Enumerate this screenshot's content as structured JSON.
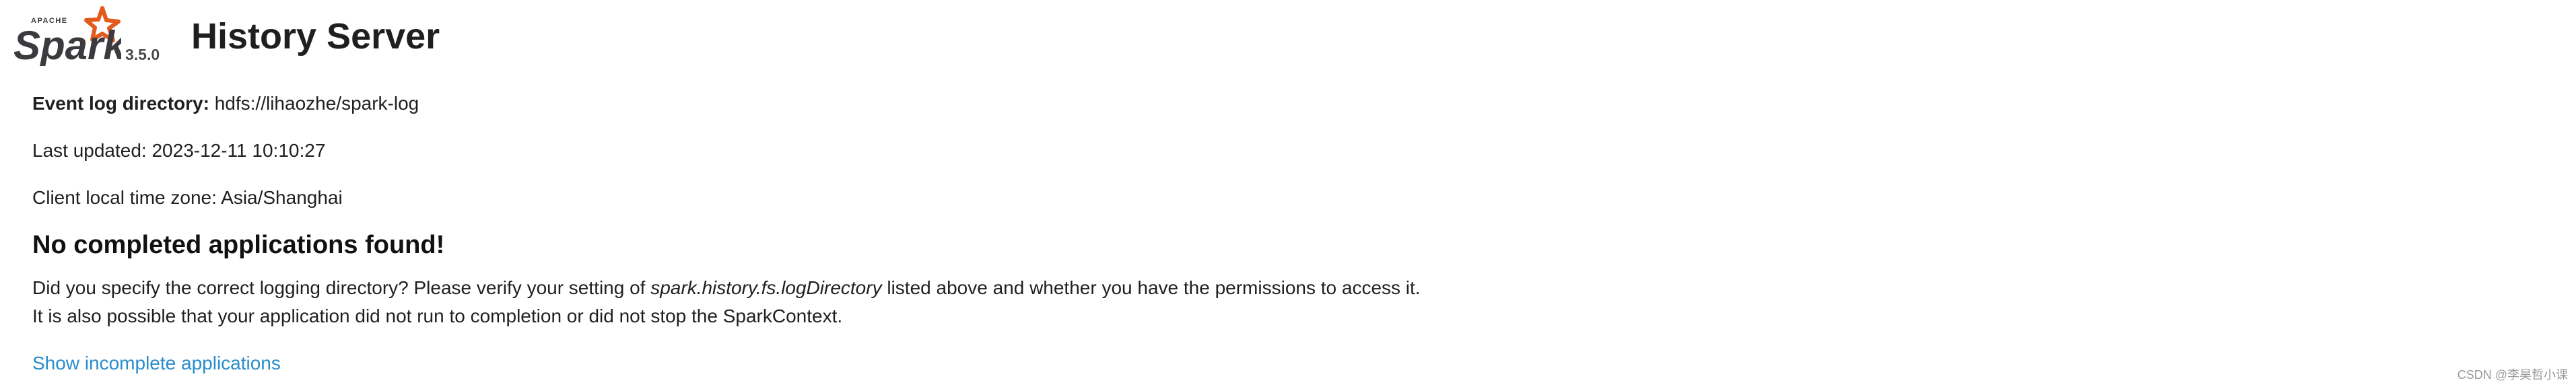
{
  "header": {
    "logo_small_text": "APACHE",
    "logo_text": "Spark",
    "version": "3.5.0",
    "title": "History Server"
  },
  "info": {
    "event_log_label": "Event log directory:",
    "event_log_value": "hdfs://lihaozhe/spark-log",
    "last_updated": "Last updated: 2023-12-11 10:10:27",
    "timezone": "Client local time zone: Asia/Shanghai"
  },
  "message": {
    "heading": "No completed applications found!",
    "line1_prefix": "Did you specify the correct logging directory? Please verify your setting of ",
    "line1_setting": "spark.history.fs.logDirectory",
    "line1_suffix": " listed above and whether you have the permissions to access it.",
    "line2": "It is also possible that your application did not run to completion or did not stop the SparkContext."
  },
  "link": {
    "show_incomplete": "Show incomplete applications"
  },
  "watermark": "CSDN @李昊哲小课",
  "colors": {
    "logo_orange": "#E25A1C",
    "logo_text": "#3C3A3E",
    "link": "#2A8CCB",
    "text": "#1F1F1F"
  }
}
